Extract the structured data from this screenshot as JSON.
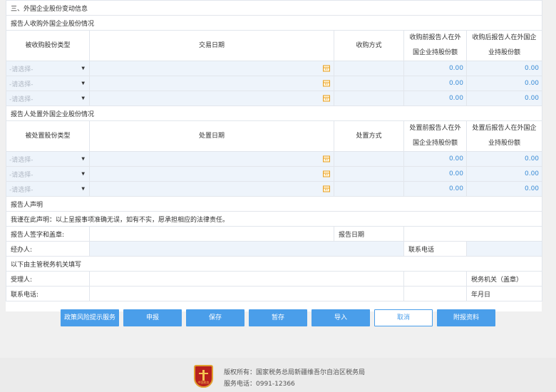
{
  "section_title": "三、外国企业股份变动信息",
  "acquisition": {
    "title": "报告人收购外国企业股份情况",
    "headers": {
      "type": "被收购股份类型",
      "date": "交易日期",
      "method": "收购方式",
      "before": "收购前报告人在外国企业持股份额",
      "after": "收购后报告人在外国企业持股份额"
    },
    "rows": [
      {
        "type": "-请选择-",
        "before": "0.00",
        "after": "0.00"
      },
      {
        "type": "-请选择-",
        "before": "0.00",
        "after": "0.00"
      },
      {
        "type": "-请选择-",
        "before": "0.00",
        "after": "0.00"
      }
    ]
  },
  "disposal": {
    "title": "报告人处置外国企业股份情况",
    "headers": {
      "type": "被处置股份类型",
      "date": "处置日期",
      "method": "处置方式",
      "before": "处置前报告人在外国企业持股份额",
      "after": "处置后报告人在外国企业持股份额"
    },
    "rows": [
      {
        "type": "-请选择-",
        "before": "0.00",
        "after": "0.00"
      },
      {
        "type": "-请选择-",
        "before": "0.00",
        "after": "0.00"
      },
      {
        "type": "-请选择-",
        "before": "0.00",
        "after": "0.00"
      }
    ]
  },
  "declaration": {
    "title": "报告人声明",
    "text": "我谨在此声明：以上呈报事项准确无误，如有不实，愿承担相应的法律责任。",
    "signature_label": "报告人签字和盖章:",
    "report_date_label": "报告日期",
    "handler_label": "经办人:",
    "phone_label": "联系电话"
  },
  "authority": {
    "title": "以下由主管税务机关填写",
    "receiver_label": "受理人:",
    "seal_label": "税务机关（盖章）",
    "phone_label": "联系电话:",
    "date_label": "年月日"
  },
  "buttons": {
    "policy_risk": "政策风险提示服务",
    "declare": "申报",
    "save": "保存",
    "temp_save": "暂存",
    "import": "导入",
    "cancel": "取消",
    "attach": "附报资料"
  },
  "footer": {
    "copyright": "版权所有：国家税务总局新疆维吾尔自治区税务局",
    "phone": "服务电话：0991-12366",
    "emblem_text": "中国税务"
  },
  "colors": {
    "button_blue": "#4a9eea",
    "input_bg": "#eef4fb",
    "value_blue": "#3c8dd6",
    "calendar_orange": "#e8a020"
  }
}
